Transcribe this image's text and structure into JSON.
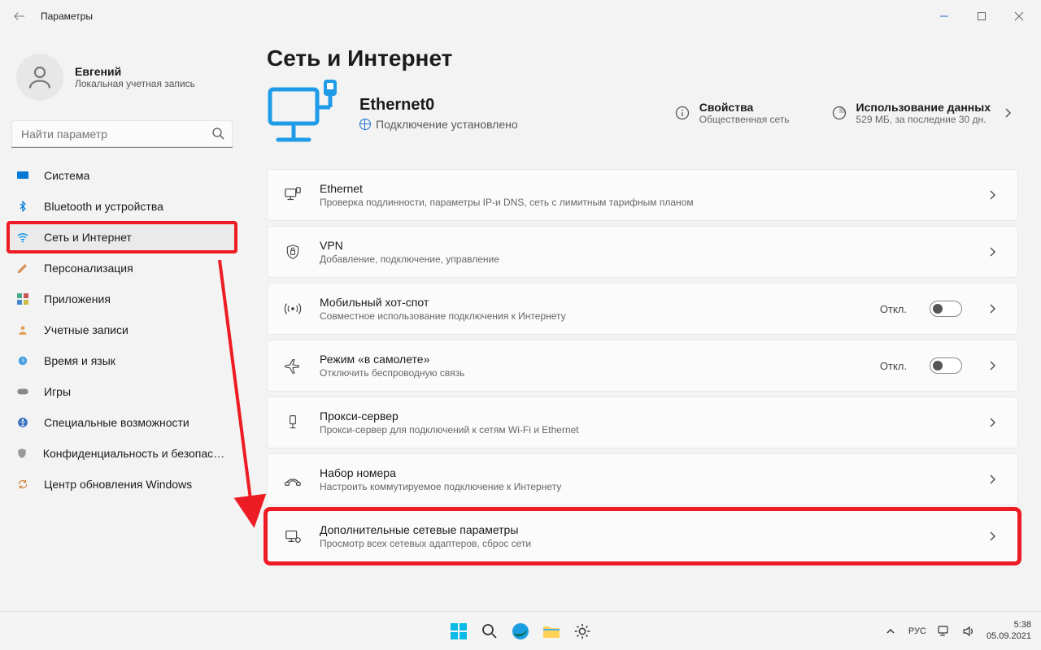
{
  "titlebar": {
    "title": "Параметры"
  },
  "account": {
    "name": "Евгений",
    "sub": "Локальная учетная запись"
  },
  "search": {
    "placeholder": "Найти параметр"
  },
  "nav": {
    "items": [
      {
        "label": "Система"
      },
      {
        "label": "Bluetooth и устройства"
      },
      {
        "label": "Сеть и Интернет"
      },
      {
        "label": "Персонализация"
      },
      {
        "label": "Приложения"
      },
      {
        "label": "Учетные записи"
      },
      {
        "label": "Время и язык"
      },
      {
        "label": "Игры"
      },
      {
        "label": "Специальные возможности"
      },
      {
        "label": "Конфиденциальность и безопасность"
      },
      {
        "label": "Центр обновления Windows"
      }
    ],
    "selected_index": 2
  },
  "page": {
    "title": "Сеть и Интернет",
    "connection": {
      "name": "Ethernet0",
      "status": "Подключение установлено"
    },
    "props": {
      "title": "Свойства",
      "sub": "Общественная сеть"
    },
    "usage": {
      "title": "Использование данных",
      "sub": "529 МБ, за последние 30 дн."
    }
  },
  "cards": [
    {
      "title": "Ethernet",
      "sub": "Проверка подлинности, параметры IP-и DNS, сеть с лимитным тарифным планом"
    },
    {
      "title": "VPN",
      "sub": "Добавление, подключение, управление"
    },
    {
      "title": "Мобильный хот-спот",
      "sub": "Совместное использование подключения к Интернету",
      "toggle": "Откл."
    },
    {
      "title": "Режим «в самолете»",
      "sub": "Отключить беспроводную связь",
      "toggle": "Откл."
    },
    {
      "title": "Прокси-сервер",
      "sub": "Прокси-сервер для подключений к сетям Wi-Fi и Ethernet"
    },
    {
      "title": "Набор номера",
      "sub": "Настроить коммутируемое подключение к Интернету"
    },
    {
      "title": "Дополнительные сетевые параметры",
      "sub": "Просмотр всех сетевых адаптеров, сброс сети"
    }
  ],
  "taskbar": {
    "lang": "РУС",
    "time": "5:38",
    "date": "05.09.2021"
  }
}
